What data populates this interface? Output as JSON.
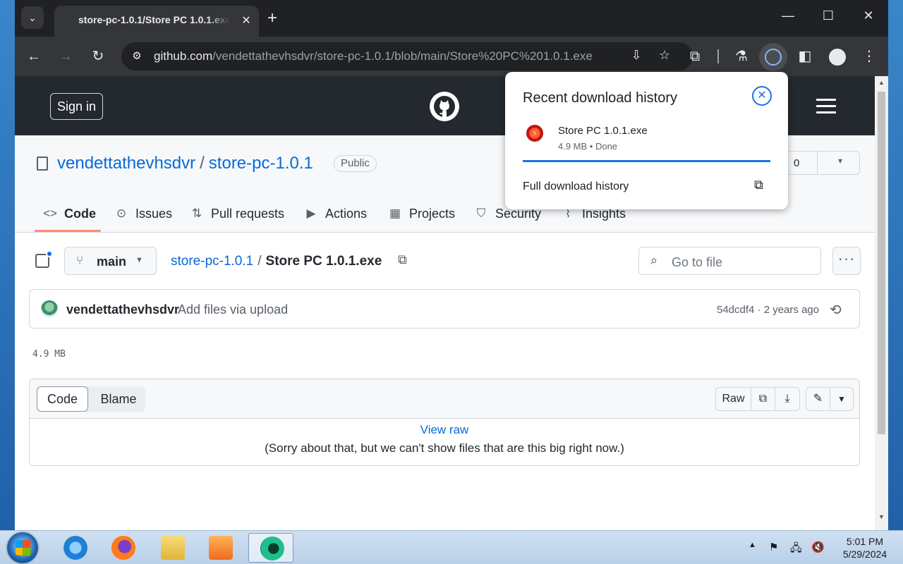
{
  "browser": {
    "tab_title": "store-pc-1.0.1/Store PC 1.0.1.exe",
    "url_host": "github.com",
    "url_path": "/vendettathevhsdvr/store-pc-1.0.1/blob/main/Store%20PC%201.0.1.exe"
  },
  "header": {
    "sign_in": "Sign in"
  },
  "repo": {
    "owner": "vendettathevhsdvr",
    "name": "store-pc-1.0.1",
    "visibility": "Public",
    "star_count": "0"
  },
  "nav_tabs": [
    {
      "label": "Code",
      "icon": "code-icon"
    },
    {
      "label": "Issues",
      "icon": "issue-icon"
    },
    {
      "label": "Pull requests",
      "icon": "pull-request-icon"
    },
    {
      "label": "Actions",
      "icon": "play-icon"
    },
    {
      "label": "Projects",
      "icon": "table-icon"
    },
    {
      "label": "Security",
      "icon": "shield-icon"
    },
    {
      "label": "Insights",
      "icon": "graph-icon"
    }
  ],
  "file_nav": {
    "branch": "main",
    "crumb_repo": "store-pc-1.0.1",
    "crumb_file": "Store PC 1.0.1.exe",
    "go_to_file_placeholder": "Go to file"
  },
  "commit": {
    "author": "vendettathevhsdvr",
    "message": "Add files via upload",
    "meta": "54dcdf4 · 2 years ago"
  },
  "file_size": "4.9 MB",
  "viewer": {
    "tab_code": "Code",
    "tab_blame": "Blame",
    "raw": "Raw",
    "view_raw": "View raw",
    "sorry": "(Sorry about that, but we can't show files that are this big right now.)"
  },
  "download_popup": {
    "title": "Recent download history",
    "file_name": "Store PC 1.0.1.exe",
    "status": "4.9 MB • Done",
    "full_history": "Full download history",
    "progress": 1.0
  },
  "taskbar": {
    "time": "5:01 PM",
    "date": "5/29/2024"
  },
  "colors": {
    "gh_header": "#24292f",
    "link": "#0969da",
    "accent_underline": "#fd8c73",
    "chrome_blue": "#1a73e8"
  }
}
